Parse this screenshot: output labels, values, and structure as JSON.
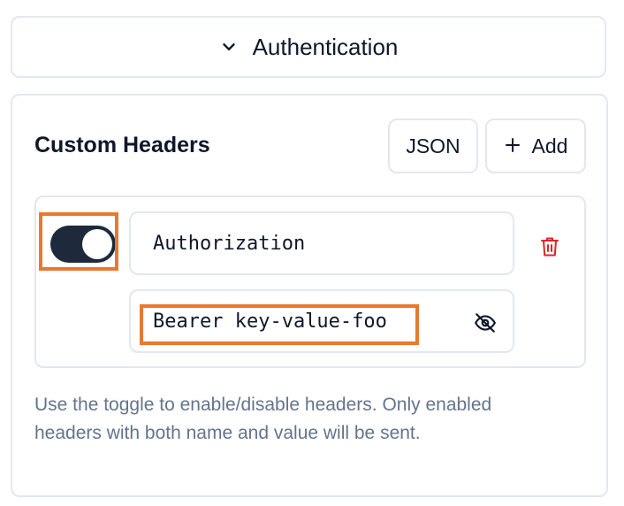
{
  "auth_section": {
    "label": "Authentication",
    "icon": "chevron-down-icon"
  },
  "custom_headers": {
    "title": "Custom Headers",
    "json_button": "JSON",
    "add_button": {
      "icon": "plus-icon",
      "label": "Add"
    },
    "headers": [
      {
        "enabled": true,
        "name": "Authorization",
        "value": "Bearer key-value-foo",
        "value_visibility_icon": "eye-off-icon",
        "delete_icon": "trash-icon"
      }
    ],
    "help_text": "Use the toggle to enable/disable headers. Only enabled headers with both name and value will be sent."
  },
  "colors": {
    "highlight": "#e8792f",
    "toggle_on": "#1e293b",
    "delete": "#dc2626",
    "border": "#e2e8f0",
    "help_text": "#64748b"
  }
}
